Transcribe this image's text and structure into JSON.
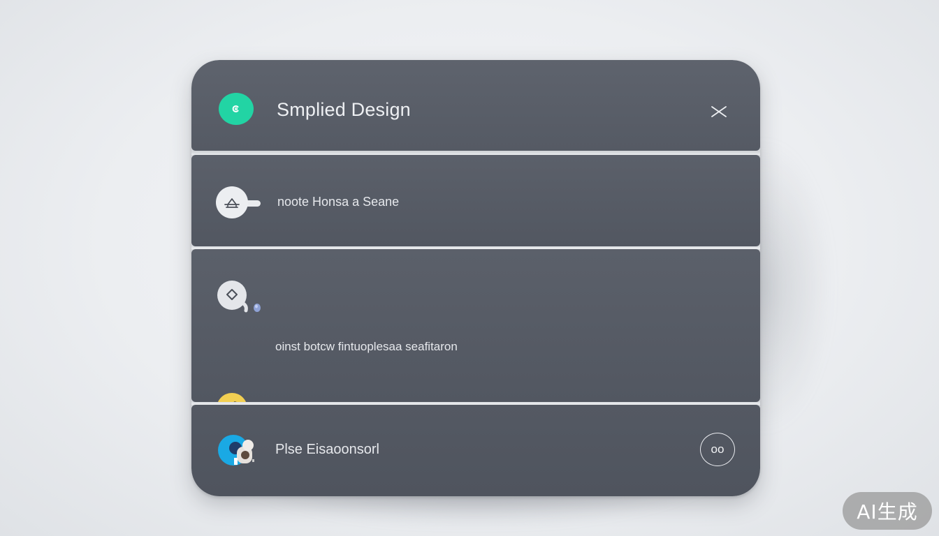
{
  "header": {
    "title": "Smplied Design",
    "icon": "green-circle-icon",
    "accent_color": "#22d4a4",
    "close_icon": "close-icon"
  },
  "rows": [
    {
      "label": "noote Honsa a Seane",
      "icon": "home-bubble-icon"
    },
    {
      "label": "",
      "icon": "tag-bubble-icon"
    },
    {
      "label": "oinst botcw fintuoplesaa seafitaron",
      "icon": "yellow-bubble-icon",
      "accent_color": "#f2cf52"
    }
  ],
  "footer": {
    "label": "Plse Eisaoonsorl",
    "avatar_icon": "avatar-icon",
    "more_label": "oo"
  },
  "watermark": "AI生成"
}
